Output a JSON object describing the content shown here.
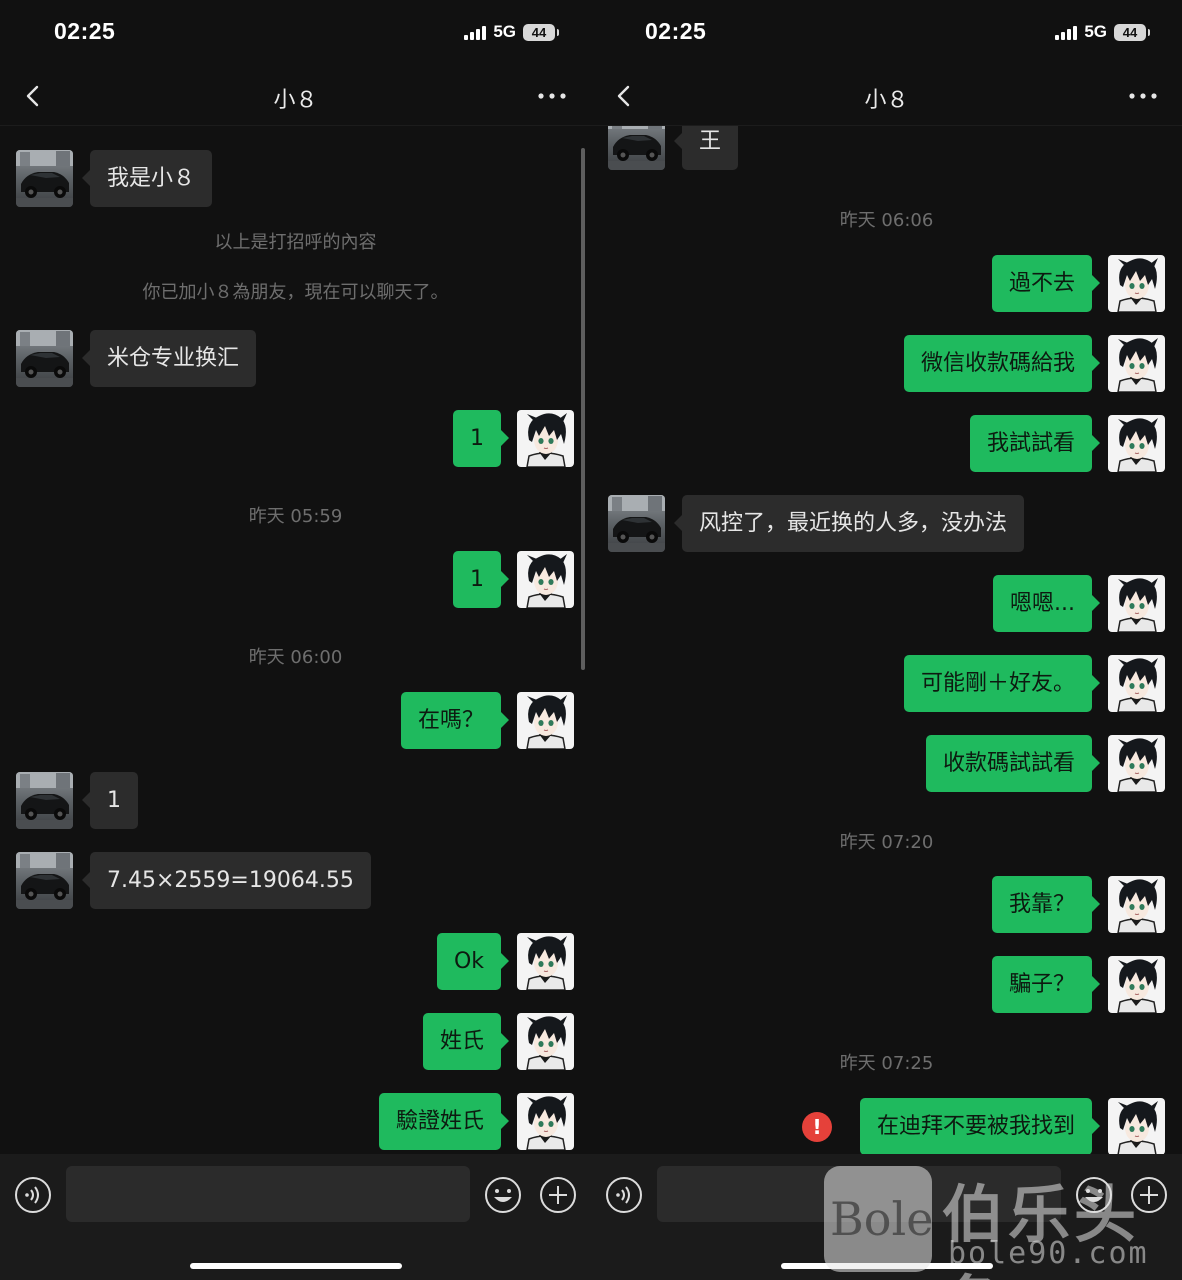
{
  "left": {
    "status": {
      "time": "02:25",
      "network": "5G",
      "battery": "44"
    },
    "title": "小８",
    "welcome_msg": "我是小８",
    "greeting_note": "以上是打招呼的內容",
    "friend_note": "你已加小８為朋友，現在可以聊天了。",
    "msg_ad": "米仓专业换汇",
    "msg_out_1": "1",
    "ts_1": "昨天 05:59",
    "msg_out_2": "1",
    "ts_2": "昨天 06:00",
    "msg_out_3": "在嗎？",
    "msg_in_1": "1",
    "msg_in_calc": "7.45×2559=19064.55",
    "msg_out_ok": "Ok",
    "msg_out_surname": "姓氏",
    "msg_out_verify": "驗證姓氏"
  },
  "right": {
    "status": {
      "time": "02:25",
      "network": "5G",
      "battery": "44"
    },
    "title": "小８",
    "msg_in_partial": "王",
    "ts_1": "昨天 06:06",
    "msg_out_1": "過不去",
    "msg_out_2": "微信收款碼給我",
    "msg_out_3": "我試試看",
    "msg_in_risk": "风控了，最近换的人多，没办法",
    "msg_out_4": "嗯嗯...",
    "msg_out_5": "可能剛＋好友。",
    "msg_out_6": "收款碼試試看",
    "ts_2": "昨天 07:20",
    "msg_out_7": "我靠？",
    "msg_out_8": "騙子？",
    "ts_3": "昨天 07:25",
    "msg_out_failed": "在迪拜不要被我找到",
    "failed_icon": "!"
  },
  "watermark": {
    "logo": "Bole",
    "name": "伯乐头条",
    "url": "bole90.com"
  },
  "colors": {
    "background": "#111111",
    "out_bubble": "#1fba5e",
    "in_bubble": "#2c2c2c",
    "error": "#e5413a"
  }
}
